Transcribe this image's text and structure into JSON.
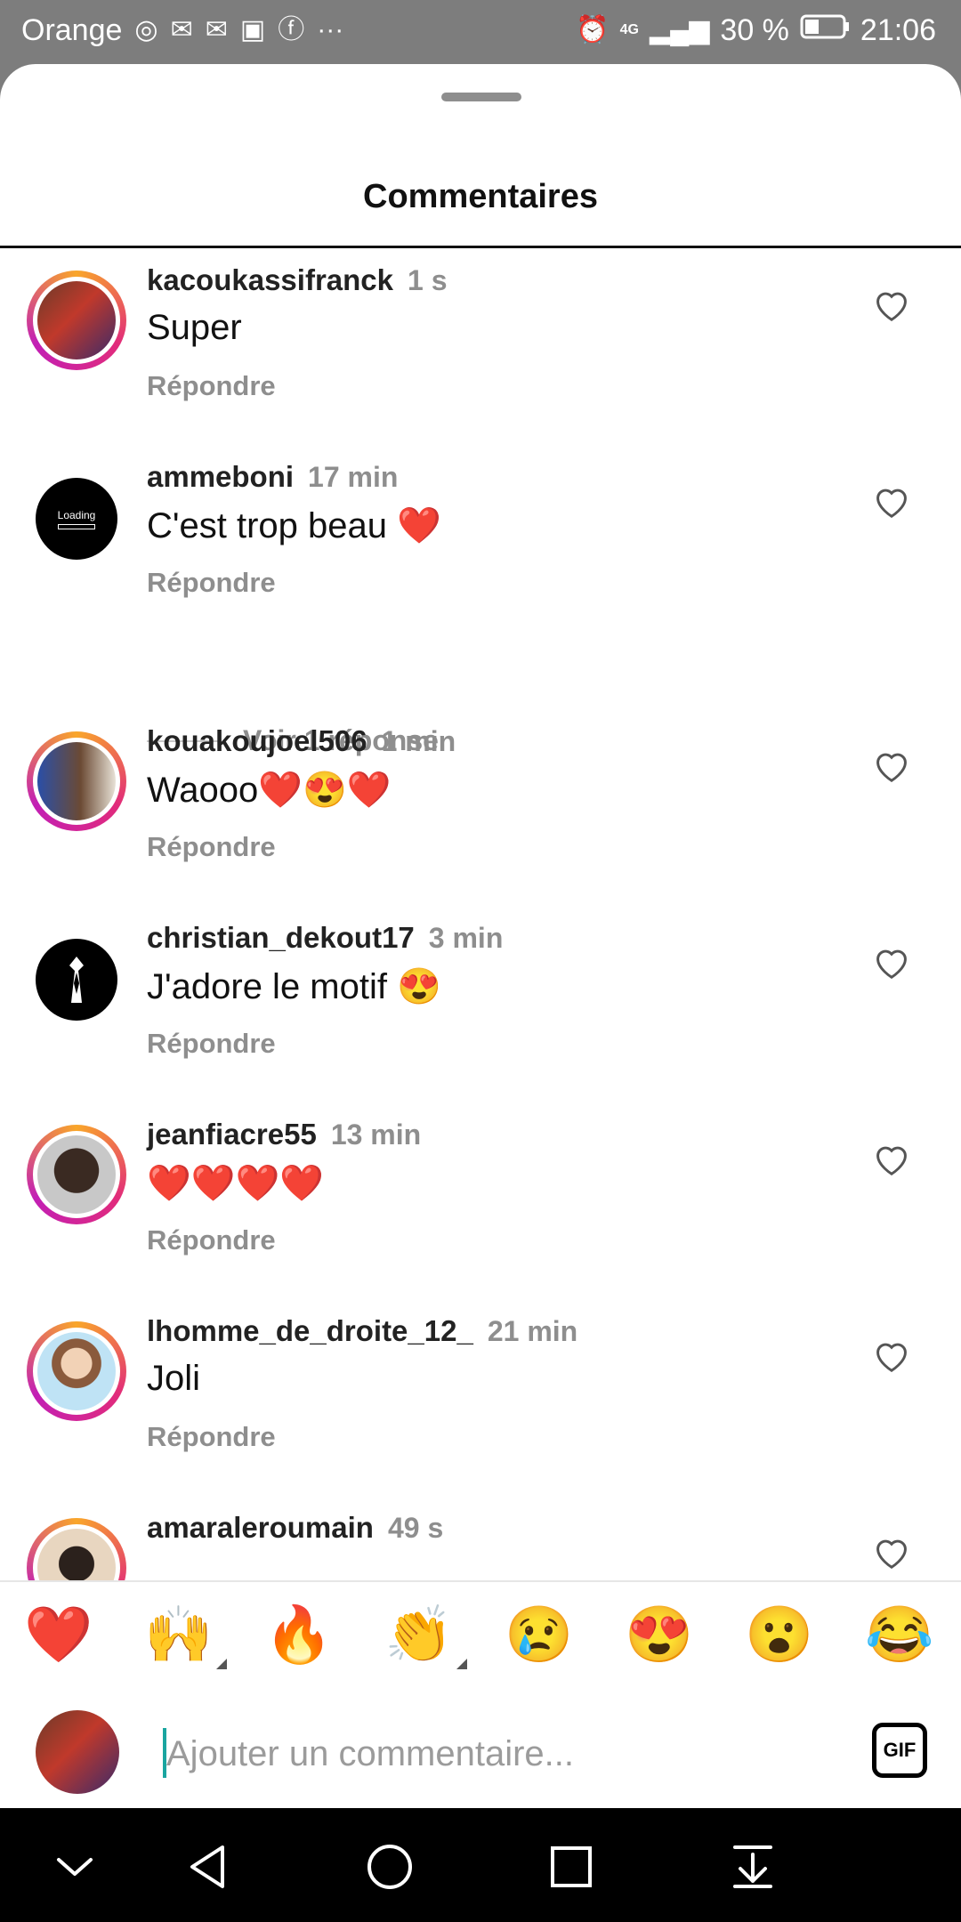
{
  "status_bar": {
    "carrier": "Orange",
    "network": "4G",
    "battery_percent": "30 %",
    "time": "21:06"
  },
  "sheet": {
    "title": "Commentaires"
  },
  "comments": [
    {
      "username": "kacoukassifranck",
      "time": "1 s",
      "text": "Super",
      "reply_label": "Répondre"
    },
    {
      "username": "ammeboni",
      "time": "17 min",
      "text": "C'est trop beau ❤️",
      "reply_label": "Répondre",
      "avatar_text": "Loading"
    },
    {
      "username": "kouakoujoel506",
      "time": "1 min",
      "text": "Waooo❤️😍❤️",
      "reply_label": "Répondre"
    },
    {
      "username": "christian_dekout17",
      "time": "3 min",
      "text": "J'adore le motif 😍",
      "reply_label": "Répondre"
    },
    {
      "username": "jeanfiacre55",
      "time": "13 min",
      "text": "❤️❤️❤️❤️",
      "reply_label": "Répondre"
    },
    {
      "username": "lhomme_de_droite_12_",
      "time": "21 min",
      "text": "Joli",
      "reply_label": "Répondre"
    },
    {
      "username": "amaraleroumain",
      "time": "49 s",
      "text": "",
      "reply_label": ""
    }
  ],
  "view_replies_label": "Voir 1 réponse",
  "reactions": [
    "❤️",
    "🙌",
    "🔥",
    "👏",
    "😢",
    "😍",
    "😮",
    "😂"
  ],
  "input": {
    "placeholder": "Ajouter un commentaire...",
    "gif_label": "GIF"
  },
  "colors": {
    "muted": "#8e8e8e",
    "ring_start": "#f9a62a",
    "ring_end": "#c21fb5",
    "caret": "#1aa5a0"
  }
}
